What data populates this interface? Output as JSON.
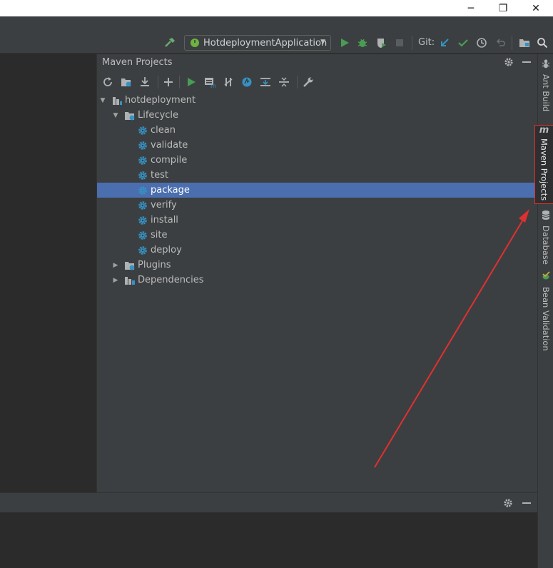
{
  "window": {
    "minimize_glyph": "─",
    "maximize_glyph": "❐",
    "close_glyph": "✕"
  },
  "toolbar": {
    "build_icon": "hammer-icon",
    "run_config": "HotdeploymentApplication",
    "git_label": "Git:",
    "icons": [
      "run-icon",
      "debug-icon",
      "coverage-icon",
      "stop-icon",
      "git-update-icon",
      "git-commit-icon",
      "git-history-icon",
      "git-revert-icon",
      "project-structure-icon",
      "search-icon"
    ]
  },
  "maven": {
    "title": "Maven Projects",
    "toolbar_icons": [
      "reimport-icon",
      "generate-sources-icon",
      "download-icon",
      "add-icon",
      "run-maven-build-icon",
      "execute-goal-icon",
      "toggle-offline-icon",
      "skip-tests-icon",
      "show-dependencies-icon",
      "collapse-all-icon",
      "settings-wrench-icon"
    ],
    "tree": {
      "project": "hotdeployment",
      "lifecycle_label": "Lifecycle",
      "goals": [
        "clean",
        "validate",
        "compile",
        "test",
        "package",
        "verify",
        "install",
        "site",
        "deploy"
      ],
      "selected_goal": "package",
      "plugins_label": "Plugins",
      "dependencies_label": "Dependencies"
    }
  },
  "right_tabs": [
    {
      "label": "Ant Build",
      "icon": "ant-icon"
    },
    {
      "label": "Maven Projects",
      "icon": "maven-m-icon",
      "active": true
    },
    {
      "label": "Database",
      "icon": "database-icon"
    },
    {
      "label": "Bean Validation",
      "icon": "bean-validation-icon"
    }
  ],
  "colors": {
    "selection": "#4b6eaf",
    "annotation": "#e03030",
    "gear": "#3592c4",
    "run_green": "#499c54"
  }
}
